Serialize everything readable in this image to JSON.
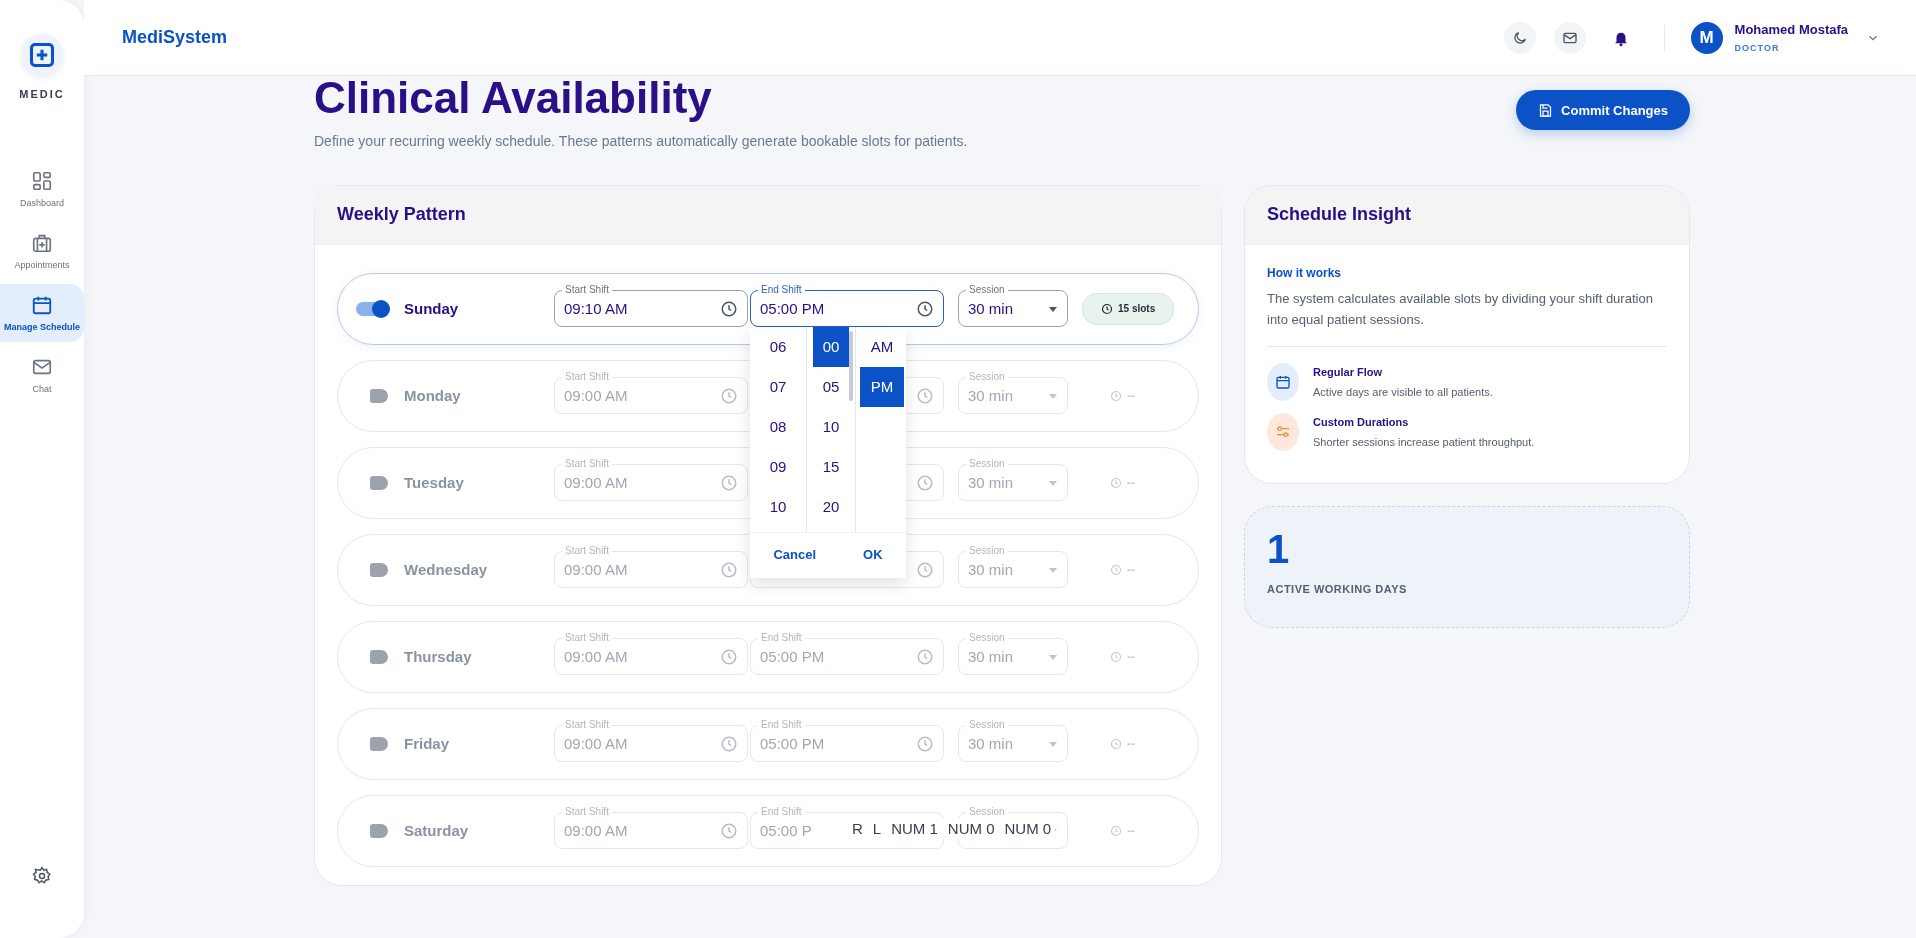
{
  "sidebar": {
    "logo": "MEDIC",
    "items": [
      {
        "label": "Dashboard",
        "kind": "grid",
        "selected": false
      },
      {
        "label": "Appointments",
        "kind": "kit",
        "selected": false
      },
      {
        "label": "Manage Schedule",
        "kind": "calendar",
        "selected": true
      },
      {
        "label": "Chat",
        "kind": "mail",
        "selected": false
      }
    ]
  },
  "header": {
    "brand": "MediSystem",
    "user": {
      "initial": "M",
      "name": "Mohamed Mostafa",
      "role": "DOCTOR"
    }
  },
  "page": {
    "title": "Clinical Availability",
    "subtitle": "Define your recurring weekly schedule. These patterns automatically generate bookable slots for patients.",
    "commit_button": "Commit Changes"
  },
  "weekly": {
    "title": "Weekly Pattern",
    "days": [
      {
        "name": "Sunday",
        "on": true,
        "start_label": "Start Shift",
        "start": "09:10 AM",
        "end_label": "End Shift",
        "end": "05:00 PM",
        "session_label": "Session",
        "session": "30 min",
        "slots": "15 slots",
        "picker_open": true
      },
      {
        "name": "Monday",
        "on": false,
        "start_label": "Start Shift",
        "start": "09:00 AM",
        "session_label": "Session",
        "session": "30 min",
        "slots": "--",
        "picker_open": false
      },
      {
        "name": "Tuesday",
        "on": false,
        "start_label": "Start Shift",
        "start": "09:00 AM",
        "session_label": "Session",
        "session": "30 min",
        "slots": "--",
        "picker_open": false
      },
      {
        "name": "Wednesday",
        "on": false,
        "start_label": "Start Shift",
        "start": "09:00 AM",
        "session_label": "Session",
        "session": "30 min",
        "slots": "--",
        "picker_open": false
      },
      {
        "name": "Thursday",
        "on": false,
        "start_label": "Start Shift",
        "start": "09:00 AM",
        "end_label": "End Shift",
        "end": "05:00 PM",
        "session_label": "Session",
        "session": "30 min",
        "slots": "--",
        "picker_open": false
      },
      {
        "name": "Friday",
        "on": false,
        "start_label": "Start Shift",
        "start": "09:00 AM",
        "end_label": "End Shift",
        "end": "05:00 PM",
        "session_label": "Session",
        "session": "30 min",
        "slots": "--",
        "picker_open": false
      },
      {
        "name": "Saturday",
        "on": false,
        "start_label": "Start Shift",
        "start": "09:00 AM",
        "end_label": "End Shift",
        "end": "05:00 P",
        "session_label": "Session",
        "slots": "--",
        "picker_open": false,
        "key_overlay": [
          "R",
          "L",
          "NUM 1",
          "NUM 0",
          "NUM 0"
        ]
      }
    ]
  },
  "picker": {
    "hours": [
      {
        "label": "06",
        "selected": false
      },
      {
        "label": "07",
        "selected": false
      },
      {
        "label": "08",
        "selected": false
      },
      {
        "label": "09",
        "selected": false
      },
      {
        "label": "10",
        "selected": false
      }
    ],
    "minutes": [
      {
        "label": "00",
        "selected": true
      },
      {
        "label": "05",
        "selected": false
      },
      {
        "label": "10",
        "selected": false
      },
      {
        "label": "15",
        "selected": false
      },
      {
        "label": "20",
        "selected": false
      }
    ],
    "periods": [
      {
        "label": "AM",
        "selected": false
      },
      {
        "label": "PM",
        "selected": true
      }
    ],
    "cancel": "Cancel",
    "ok": "OK"
  },
  "insight": {
    "title": "Schedule Insight",
    "how_title": "How it works",
    "how_text": "The system calculates available slots by dividing your shift duration into equal patient sessions.",
    "items": [
      {
        "kind": "calendar",
        "title": "Regular Flow",
        "text": "Active days are visible to all patients."
      },
      {
        "kind": "sliders",
        "title": "Custom Durations",
        "text": "Shorter sessions increase patient throughput."
      }
    ]
  },
  "stat": {
    "value": "1",
    "label": "ACTIVE WORKING DAYS"
  }
}
